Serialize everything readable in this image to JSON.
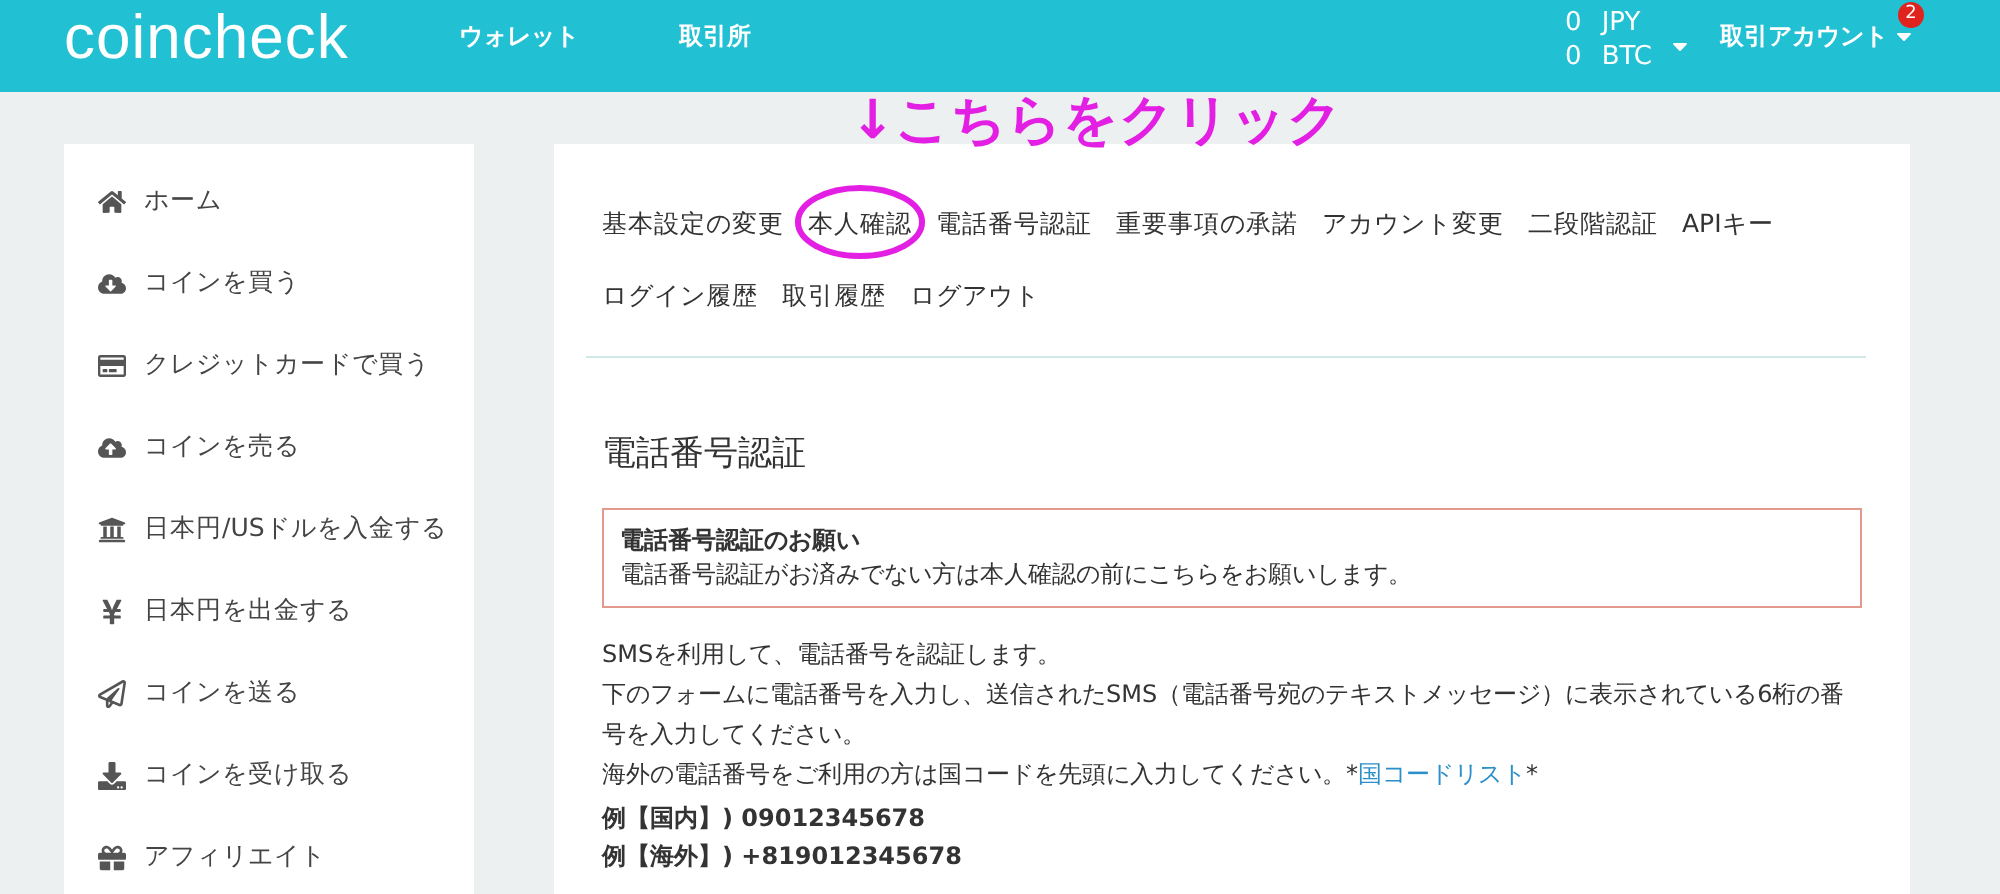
{
  "header": {
    "logo": "coincheck",
    "nav": [
      "ウォレット",
      "取引所"
    ],
    "balances": [
      {
        "amount": "0",
        "currency": "JPY"
      },
      {
        "amount": "0",
        "currency": "BTC"
      }
    ],
    "account_menu": "取引アカウント",
    "notification_badge": "2"
  },
  "annotation": "↓こちらをクリック",
  "sidebar": {
    "items": [
      "ホーム",
      "コインを買う",
      "クレジットカードで買う",
      "コインを売る",
      "日本円/USドルを入金する",
      "日本円を出金する",
      "コインを送る",
      "コインを受け取る",
      "アフィリエイト"
    ]
  },
  "tabs": [
    [
      {
        "label": "基本設定の変更",
        "circled": false
      },
      {
        "label": "本人確認",
        "circled": true
      },
      {
        "label": "電話番号認証",
        "circled": false
      },
      {
        "label": "重要事項の承諾",
        "circled": false
      },
      {
        "label": "アカウント変更",
        "circled": false
      },
      {
        "label": "二段階認証",
        "circled": false
      },
      {
        "label": "APIキー",
        "circled": false
      }
    ],
    [
      {
        "label": "ログイン履歴",
        "circled": false
      },
      {
        "label": "取引履歴",
        "circled": false
      },
      {
        "label": "ログアウト",
        "circled": false
      }
    ]
  ],
  "section": {
    "title": "電話番号認証",
    "alert": {
      "title": "電話番号認証のお願い",
      "message": "電話番号認証がお済みでない方は本人確認の前にこちらをお願いします。"
    },
    "paragraphs": [
      "SMSを利用して、電話番号を認証します。",
      "下のフォームに電話番号を入力し、送信されたSMS（電話番号宛のテキストメッセージ）に表示されている6桁の番号を入力してください。"
    ],
    "overseas_note": {
      "before": "海外の電話番号をご利用の方は国コードを先頭に入力してください。*",
      "link": "国コードリスト",
      "after": "*"
    },
    "examples": [
      "例【国内】) 09012345678",
      "例【海外】) +819012345678"
    ]
  }
}
